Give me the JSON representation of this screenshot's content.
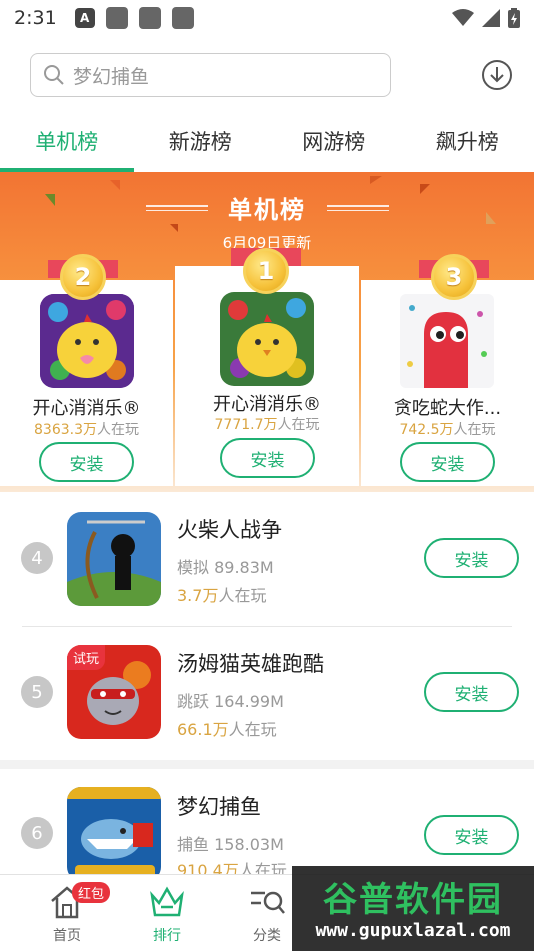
{
  "status": {
    "time": "2:31"
  },
  "search": {
    "placeholder": "梦幻捕鱼"
  },
  "tabs": [
    {
      "label": "单机榜",
      "active": true
    },
    {
      "label": "新游榜",
      "active": false
    },
    {
      "label": "网游榜",
      "active": false
    },
    {
      "label": "飙升榜",
      "active": false
    }
  ],
  "banner": {
    "title": "单机榜",
    "date": "6月09日更新"
  },
  "podium": [
    {
      "rank": "2",
      "name": "开心消消乐®",
      "players_num": "8363.3万",
      "players_suffix": "人在玩",
      "install": "安装",
      "icon": "chick-game-icon"
    },
    {
      "rank": "1",
      "name": "开心消消乐®",
      "players_num": "7771.7万",
      "players_suffix": "人在玩",
      "install": "安装",
      "icon": "chick-game-icon"
    },
    {
      "rank": "3",
      "name": "贪吃蛇大作...",
      "players_num": "742.5万",
      "players_suffix": "人在玩",
      "install": "安装",
      "icon": "snake-game-icon"
    }
  ],
  "list": [
    {
      "rank": "4",
      "name": "火柴人战争",
      "category": "模拟",
      "size": "89.83M",
      "players_num": "3.7万",
      "players_suffix": "人在玩",
      "install": "安装",
      "icon": "stickman-game-icon"
    },
    {
      "rank": "5",
      "name": "汤姆猫英雄跑酷",
      "category": "跳跃",
      "size": "164.99M",
      "players_num": "66.1万",
      "players_suffix": "人在玩",
      "install": "安装",
      "icon": "tom-cat-game-icon",
      "tag": "试玩"
    },
    {
      "rank": "6",
      "name": "梦幻捕鱼",
      "category": "捕鱼",
      "size": "158.03M",
      "players_num": "910.4万",
      "players_suffix": "人在玩",
      "install": "安装",
      "icon": "shark-game-icon"
    }
  ],
  "bottom_nav": [
    {
      "label": "首页",
      "badge": "红包"
    },
    {
      "label": "排行",
      "active": true
    },
    {
      "label": "分类"
    }
  ],
  "watermark": {
    "title": "谷普软件园",
    "url": "www.gupuxlazal.com"
  },
  "colors": {
    "accent": "#1fb073",
    "banner": "#f27433",
    "players": "#d9a441"
  }
}
